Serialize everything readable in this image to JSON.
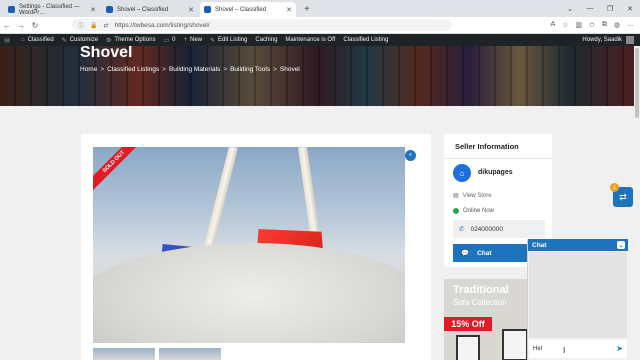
{
  "browser": {
    "tabs": [
      {
        "title": "Settings - Classified — WordPr…",
        "active": false
      },
      {
        "title": "Shovel – Classified",
        "active": false
      },
      {
        "title": "Shovel – Classified",
        "active": true
      }
    ],
    "new_tab": "+",
    "url": "https://twbesa.com/listing/shovel/"
  },
  "adminbar": {
    "items": [
      "Classified",
      "Customize",
      "Theme Options",
      "0",
      "New",
      "Edit Listing",
      "Caching",
      "Maintenance is Off",
      "Classified Listing"
    ],
    "greeting": "Howdy, Saadik"
  },
  "hero": {
    "title": "Shovel",
    "breadcrumb": [
      "Home",
      "Classified Listings",
      "Building Materials",
      "Building Tools",
      "Shovel"
    ],
    "separator": ">"
  },
  "listing": {
    "badge": "SOLD OUT"
  },
  "seller": {
    "heading": "Seller Information",
    "name": "dikupages",
    "view_store": "View Store",
    "status": "Online Now",
    "phone": "024000000",
    "chat_label": "Chat"
  },
  "promo": {
    "line1": "Traditional",
    "line2": "Sofa Collection",
    "discount": "15% Off"
  },
  "chat_widget": {
    "title": "Chat",
    "input_value": "Hel"
  },
  "float": {
    "badge_count": "1"
  },
  "colors": {
    "primary": "#1e73be",
    "danger": "#e01b24",
    "online": "#2ea44f",
    "adminbar": "#1d2327"
  }
}
